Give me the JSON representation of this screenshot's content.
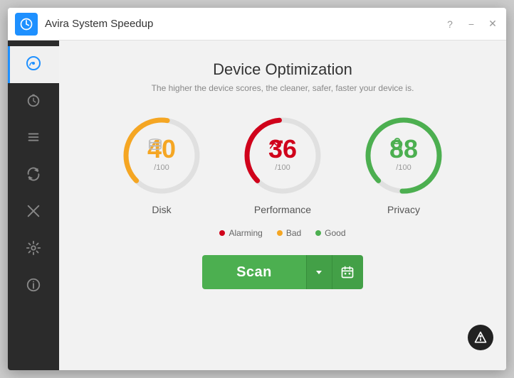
{
  "titlebar": {
    "title": "Avira System Speedup",
    "help_label": "?",
    "minimize_label": "−",
    "close_label": "✕"
  },
  "sidebar": {
    "items": [
      {
        "id": "dashboard",
        "icon": "⚡",
        "active": true
      },
      {
        "id": "timer",
        "icon": "⏱"
      },
      {
        "id": "list",
        "icon": "☰"
      },
      {
        "id": "refresh",
        "icon": "↺"
      },
      {
        "id": "tools",
        "icon": "✂"
      },
      {
        "id": "settings",
        "icon": "⚙"
      },
      {
        "id": "info",
        "icon": "ℹ"
      }
    ]
  },
  "content": {
    "title": "Device Optimization",
    "subtitle": "The higher the device scores, the cleaner, safer, faster your device is.",
    "scores": [
      {
        "id": "disk",
        "value": 40,
        "denom": "/100",
        "label": "Disk",
        "color": "#f5a623",
        "track_color": "#e0e0e0",
        "percent": 40,
        "icon": "💾",
        "icon_color": "#ccc"
      },
      {
        "id": "performance",
        "value": 36,
        "denom": "/100",
        "label": "Performance",
        "color": "#d0021b",
        "track_color": "#e0e0e0",
        "percent": 36,
        "icon": "📈",
        "icon_color": "#d0021b"
      },
      {
        "id": "privacy",
        "value": 88,
        "denom": "/100",
        "label": "Privacy",
        "color": "#4caf50",
        "track_color": "#e0e0e0",
        "percent": 88,
        "icon": "🔒",
        "icon_color": "#4caf50"
      }
    ],
    "legend": [
      {
        "label": "Alarming",
        "color": "#d0021b"
      },
      {
        "label": "Bad",
        "color": "#f5a623"
      },
      {
        "label": "Good",
        "color": "#4caf50"
      }
    ],
    "scan_button": "Scan",
    "dropdown_icon": "▼",
    "calendar_icon": "📅"
  }
}
